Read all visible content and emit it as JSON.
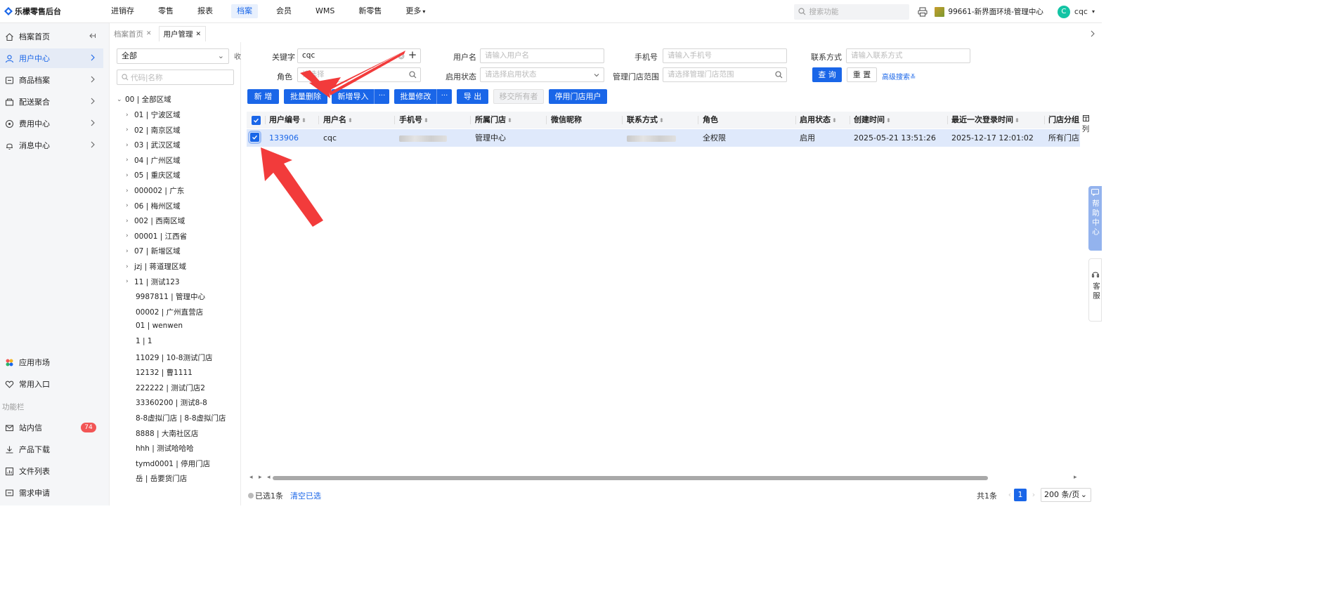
{
  "app": {
    "title": "乐檬零售后台"
  },
  "top_nav": [
    {
      "label": "进销存",
      "active": false
    },
    {
      "label": "零售",
      "active": false
    },
    {
      "label": "报表",
      "active": false
    },
    {
      "label": "档案",
      "active": true
    },
    {
      "label": "会员",
      "active": false
    },
    {
      "label": "WMS",
      "active": false
    },
    {
      "label": "新零售",
      "active": false
    },
    {
      "label": "更多",
      "active": false
    }
  ],
  "header": {
    "search_placeholder": "搜索功能",
    "store": "99661-新界面环境-管理中心",
    "user_initial": "C",
    "user_name": "cqc"
  },
  "sidebar": {
    "items": [
      {
        "label": "档案首页",
        "icon": "home-icon"
      },
      {
        "label": "用户中心",
        "icon": "user-icon",
        "active": true
      },
      {
        "label": "商品档案",
        "icon": "goods-icon"
      },
      {
        "label": "配送聚合",
        "icon": "delivery-icon"
      },
      {
        "label": "费用中心",
        "icon": "fee-icon"
      },
      {
        "label": "消息中心",
        "icon": "bell-icon"
      }
    ],
    "bottom_items": [
      {
        "label": "应用市场",
        "icon": "app-market-icon"
      },
      {
        "label": "常用入口",
        "icon": "heart-icon"
      }
    ],
    "section_label": "功能栏",
    "function_items": [
      {
        "label": "站内信",
        "icon": "mail-icon",
        "badge": "74"
      },
      {
        "label": "产品下载",
        "icon": "download-icon"
      },
      {
        "label": "文件列表",
        "icon": "file-list-icon"
      },
      {
        "label": "需求申请",
        "icon": "request-icon"
      }
    ]
  },
  "tabs": [
    {
      "label": "档案首页",
      "active": false
    },
    {
      "label": "用户管理",
      "active": true
    }
  ],
  "tree": {
    "select_value": "全部",
    "collapse_label": "收",
    "search_placeholder": "代码|名称",
    "root": "00 | 全部区域",
    "nodes": [
      {
        "label": "01 | 宁波区域",
        "expandable": true
      },
      {
        "label": "02 | 南京区域",
        "expandable": true
      },
      {
        "label": "03 | 武汉区域",
        "expandable": true
      },
      {
        "label": "04 | 广州区域",
        "expandable": true
      },
      {
        "label": "05 | 重庆区域",
        "expandable": true
      },
      {
        "label": "000002 | 广东",
        "expandable": true
      },
      {
        "label": "06 | 梅州区域",
        "expandable": true
      },
      {
        "label": "002 | 西南区域",
        "expandable": true
      },
      {
        "label": "00001 | 江西省",
        "expandable": true
      },
      {
        "label": "07 | 新增区域",
        "expandable": true
      },
      {
        "label": "jzj | 蒋道理区域",
        "expandable": true
      },
      {
        "label": "11 | 测试123",
        "expandable": true
      },
      {
        "label": "9987811 | 管理中心",
        "expandable": false
      },
      {
        "label": "00002 | 广州直营店",
        "expandable": false
      },
      {
        "label": "01 | wenwen",
        "expandable": false
      },
      {
        "label": "1 | 1",
        "expandable": false
      },
      {
        "label": "11029 | 10-8测试门店",
        "expandable": false
      },
      {
        "label": "12132 | 曹1111",
        "expandable": false
      },
      {
        "label": "222222 | 测试门店2",
        "expandable": false
      },
      {
        "label": "33360200 | 测试8-8",
        "expandable": false
      },
      {
        "label": "8-8虚拟门店 | 8-8虚拟门店",
        "expandable": false
      },
      {
        "label": "8888 | 大南社区店",
        "expandable": false
      },
      {
        "label": "hhh | 测试哈哈哈",
        "expandable": false
      },
      {
        "label": "tymd0001 | 停用门店",
        "expandable": false
      },
      {
        "label": "岳 | 岳要货门店",
        "expandable": false
      }
    ]
  },
  "filters": {
    "keyword_label": "关键字",
    "keyword_value": "cqc",
    "username_label": "用户名",
    "username_placeholder": "请输入用户名",
    "phone_label": "手机号",
    "phone_placeholder": "请输入手机号",
    "contact_label": "联系方式",
    "contact_placeholder": "请输入联系方式",
    "role_label": "角色",
    "role_placeholder": "请选择",
    "status_label": "启用状态",
    "status_placeholder": "请选择启用状态",
    "store_range_label": "管理门店范围",
    "store_range_placeholder": "请选择管理门店范围",
    "query_label": "查 询",
    "reset_label": "重 置",
    "advanced_label": "高级搜索"
  },
  "actions": {
    "add": "新 增",
    "batch_delete": "批量删除",
    "batch_import": "新增导入",
    "batch_edit": "批量修改",
    "export": "导 出",
    "transfer_owner": "移交所有者",
    "disable_store_user": "停用门店用户",
    "more": "···"
  },
  "table": {
    "columns": [
      "用户编号",
      "用户名",
      "手机号",
      "所属门店",
      "微信昵称",
      "联系方式",
      "角色",
      "启用状态",
      "创建时间",
      "最近一次登录时间",
      "门店分组"
    ],
    "rows": [
      {
        "id": "133906",
        "username": "cqc",
        "store": "管理中心",
        "role": "全权限",
        "status": "启用",
        "created": "2025-05-21 13:51:26",
        "last_login": "2025-12-17 12:01:02",
        "store_group": "所有门店"
      }
    ],
    "column_settings_label": "列"
  },
  "floating": {
    "help": "帮助中心",
    "service": "客服"
  },
  "footer": {
    "selected_text": "已选1条",
    "clear_label": "清空已选",
    "total_text": "共1条",
    "current_page": "1",
    "page_size": "200 条/页"
  },
  "colors": {
    "primary": "#1a66e8",
    "arrow_annotation": "#f23b3b",
    "badge": "#f25555"
  }
}
